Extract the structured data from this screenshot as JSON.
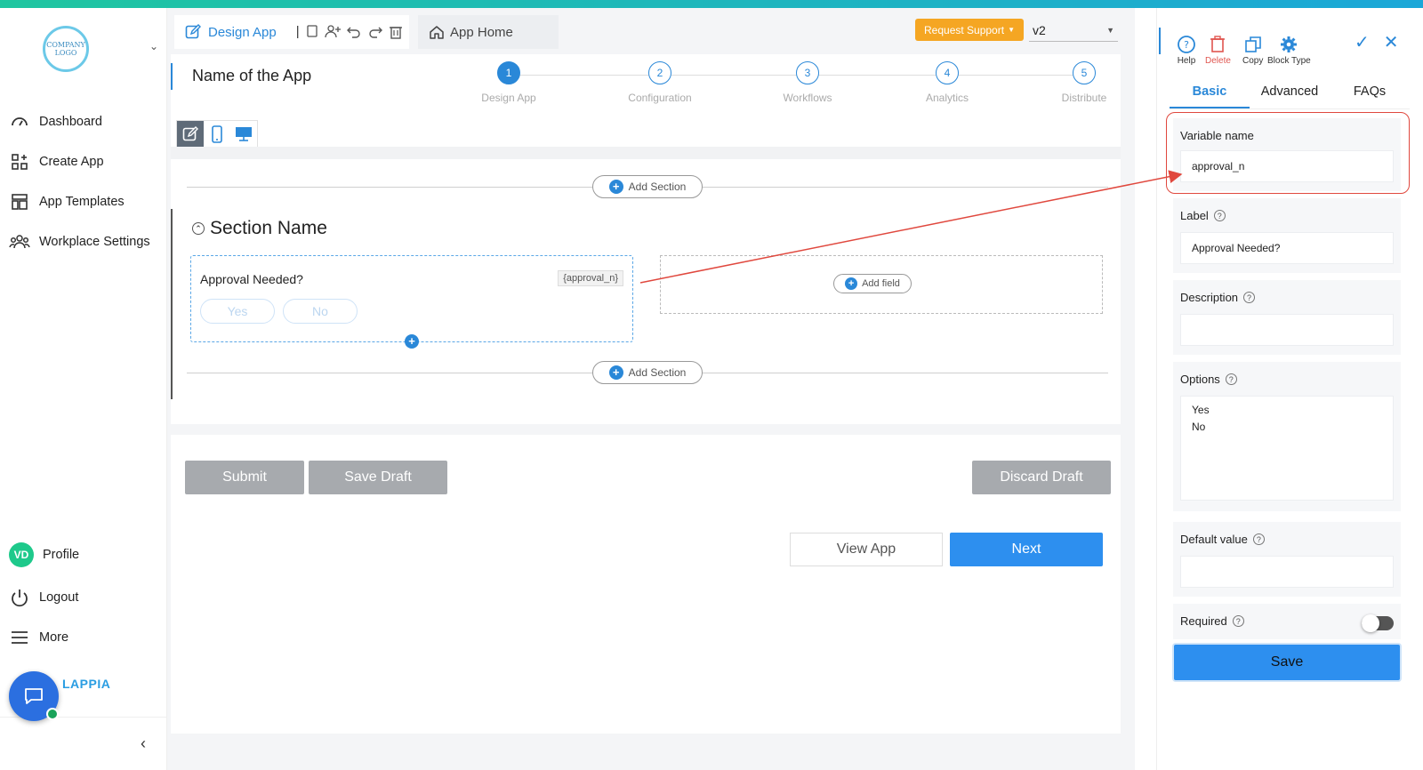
{
  "sidebar": {
    "logo_text": "COMPANY LOGO",
    "items": [
      {
        "label": "Dashboard",
        "icon": "dashboard-icon"
      },
      {
        "label": "Create App",
        "icon": "create-app-icon"
      },
      {
        "label": "App Templates",
        "icon": "templates-icon"
      },
      {
        "label": "Workplace Settings",
        "icon": "team-icon"
      }
    ],
    "profile": {
      "initials": "VD",
      "label": "Profile"
    },
    "logout_label": "Logout",
    "more_label": "More",
    "brand": "LAPPIA"
  },
  "header": {
    "design_tab": "Design App",
    "home_tab": "App Home",
    "request_support": "Request Support",
    "version": "v2"
  },
  "builder": {
    "app_name": "Name of the App",
    "steps": [
      {
        "num": "1",
        "label": "Design App"
      },
      {
        "num": "2",
        "label": "Configuration"
      },
      {
        "num": "3",
        "label": "Workflows"
      },
      {
        "num": "4",
        "label": "Analytics"
      },
      {
        "num": "5",
        "label": "Distribute"
      }
    ],
    "add_section": "Add Section",
    "section_name": "Section Name",
    "field": {
      "label": "Approval Needed?",
      "var_tag": "{approval_n}",
      "options": [
        "Yes",
        "No"
      ]
    },
    "add_field": "Add field"
  },
  "actions": {
    "submit": "Submit",
    "save_draft": "Save Draft",
    "discard_draft": "Discard Draft",
    "view_app": "View App",
    "next": "Next"
  },
  "panel": {
    "tools": [
      {
        "label": "Help",
        "icon": "help-icon"
      },
      {
        "label": "Delete",
        "icon": "trash-icon"
      },
      {
        "label": "Copy",
        "icon": "copy-icon"
      },
      {
        "label": "Block Type",
        "icon": "gear-icon"
      }
    ],
    "tabs": [
      "Basic",
      "Advanced",
      "FAQs"
    ],
    "variable_name_label": "Variable name",
    "variable_name_value": "approval_n",
    "label_label": "Label",
    "label_value": "Approval Needed?",
    "description_label": "Description",
    "description_value": "",
    "options_label": "Options",
    "options": [
      "Yes",
      "No"
    ],
    "default_value_label": "Default value",
    "default_value": "",
    "required_label": "Required",
    "save": "Save"
  },
  "colors": {
    "accent": "#2a88d8",
    "primary_button": "#2d8fef",
    "support_button": "#f5a623",
    "highlight": "#e0483e"
  }
}
